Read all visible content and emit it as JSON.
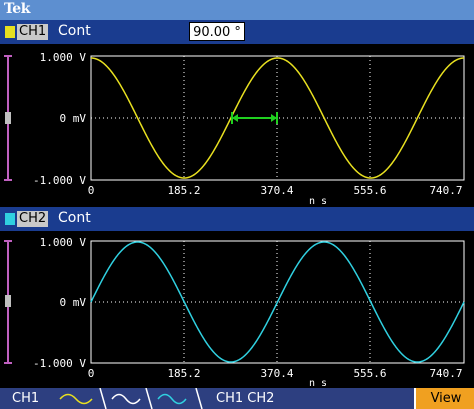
{
  "title": {
    "logo": "Tek"
  },
  "ch1": {
    "tag": "CH1",
    "mode": "Cont",
    "phase_value": "90.00 °",
    "color": "#e8e020",
    "y_labels": [
      "1.000 V",
      "0 mV",
      "-1.000 V"
    ],
    "x_labels": [
      "0",
      "185.2",
      "370.4",
      "555.6",
      "740.7"
    ],
    "x_unit": "n s"
  },
  "ch2": {
    "tag": "CH2",
    "mode": "Cont",
    "color": "#30d0e0",
    "y_labels": [
      "1.000 V",
      "0 mV",
      "-1.000 V"
    ],
    "x_labels": [
      "0",
      "185.2",
      "370.4",
      "555.6",
      "740.7"
    ],
    "x_unit": "n s"
  },
  "softkeys": {
    "ch1_label": "CH1",
    "ch1_ch2_label": "CH1  CH2",
    "view_label": "View"
  },
  "colors": {
    "header_bg": "#1a3c8f",
    "title_bg": "#5d8fd0",
    "grid": "#ffffff",
    "marker": "#20d020",
    "axis_marker": "#c060c0",
    "view_bg": "#f0a020"
  }
}
